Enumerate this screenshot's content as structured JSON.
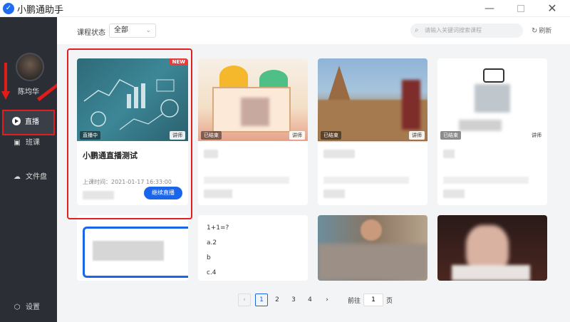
{
  "app": {
    "title": "小鹏通助手"
  },
  "window": {
    "minimize": "—",
    "close": "✕"
  },
  "sidebar": {
    "user_name": "陈均华",
    "items": [
      {
        "label": "直播",
        "icon": "play-icon",
        "active": true
      },
      {
        "label": "班课",
        "icon": "class-icon"
      },
      {
        "label": "文件盘",
        "icon": "cloud-drive-icon"
      },
      {
        "label": "设置",
        "icon": "gear-icon"
      }
    ]
  },
  "filter": {
    "label": "课程状态",
    "value": "全部"
  },
  "search": {
    "placeholder": "请输入关键词搜索课程"
  },
  "refresh": {
    "label": "刷新"
  },
  "cards": [
    {
      "title": "小鹏通直播测试",
      "time": "上课时间：2021-01-17 16:33:00",
      "status": "直播中",
      "type": "讲师",
      "badge": "NEW",
      "button": "继续直播"
    },
    {
      "status": "已结束",
      "type": "讲师"
    },
    {
      "status": "已结束",
      "type": "讲师"
    },
    {
      "status": "已结束",
      "type": "讲师"
    },
    {},
    {
      "text": "1+1=?\na.2\nb\nc.4"
    },
    {},
    {}
  ],
  "pagination": {
    "pages": [
      "1",
      "2",
      "3",
      "4"
    ],
    "current": "1",
    "prev": "‹",
    "next": "›",
    "goto_label": "前往",
    "goto_value": "1",
    "goto_unit": "页"
  },
  "colors": {
    "accent": "#1a66ea",
    "sidebar": "#2b2e35",
    "highlight": "#e02020"
  }
}
